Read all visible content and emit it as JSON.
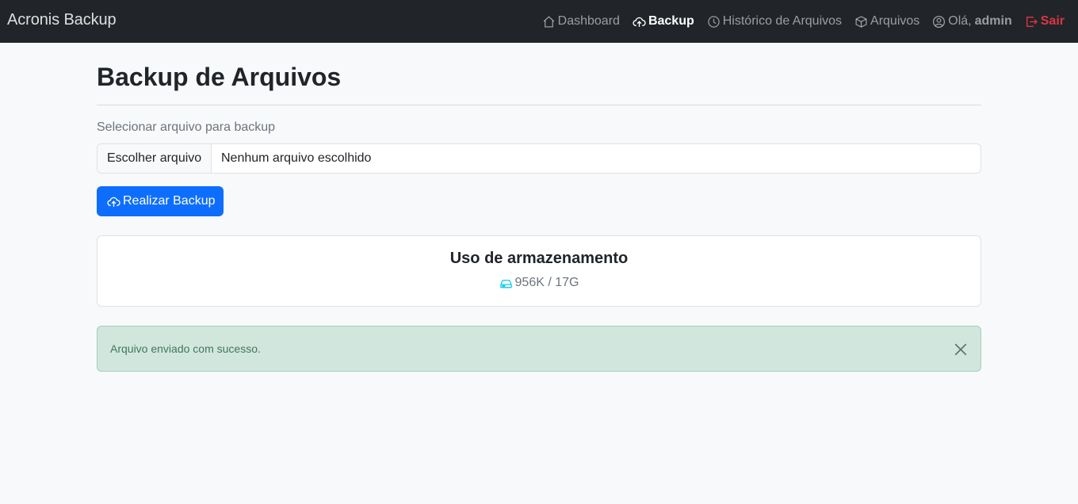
{
  "navbar": {
    "brand": "Acronis Backup",
    "items": [
      {
        "label": "Dashboard",
        "icon": "house-icon"
      },
      {
        "label": "Backup",
        "icon": "cloud-upload-icon"
      },
      {
        "label": "Histórico de Arquivos",
        "icon": "clock-history-icon"
      },
      {
        "label": "Arquivos",
        "icon": "box-icon"
      }
    ],
    "greeting": "Olá,",
    "username": "admin",
    "logout": "Sair"
  },
  "page": {
    "title": "Backup de Arquivos",
    "file_label": "Selecionar arquivo para backup",
    "choose_file": "Escolher arquivo",
    "no_file": "Nenhum arquivo escolhido",
    "submit": "Realizar Backup"
  },
  "storage": {
    "title": "Uso de armazenamento",
    "usage": "956K / 17G"
  },
  "alert": {
    "message": "Arquivo enviado com sucesso."
  },
  "colors": {
    "navbar": "#212529",
    "primary": "#0d6efd",
    "danger": "#dc3545",
    "success_bg": "#d1e7dd",
    "info_icon": "#0dcaf0"
  }
}
